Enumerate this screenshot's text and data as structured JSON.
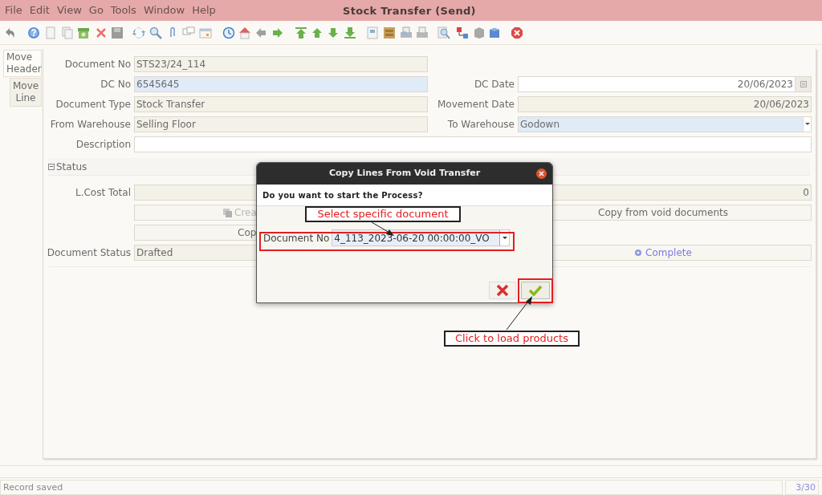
{
  "window": {
    "title": "Stock Transfer (Send)"
  },
  "menu": [
    "File",
    "Edit",
    "View",
    "Go",
    "Tools",
    "Window",
    "Help"
  ],
  "tabs": [
    {
      "label": "Move Header",
      "selected": true
    },
    {
      "label": "Move Line",
      "selected": false
    }
  ],
  "form": {
    "rows": [
      {
        "left": {
          "label": "Document No",
          "value": "STS23/24_114",
          "kind": "readonly"
        }
      },
      {
        "left": {
          "label": "DC No",
          "value": "6545645",
          "kind": "mandatory"
        },
        "right": {
          "label": "DC Date",
          "value": "20/06/2023",
          "kind": "editable",
          "has_calendar": true
        }
      },
      {
        "left": {
          "label": "Document Type",
          "value": "Stock Transfer",
          "kind": "readonly"
        },
        "right": {
          "label": "Movement Date",
          "value": "20/06/2023",
          "kind": "readonly"
        }
      },
      {
        "left": {
          "label": "From Warehouse",
          "value": "Selling Floor",
          "kind": "readonly"
        },
        "right": {
          "label": "To Warehouse",
          "value": "Godown",
          "kind": "mandatory",
          "has_dropdown": true
        }
      },
      {
        "full": {
          "label": "Description",
          "kind": "editable"
        }
      }
    ],
    "section": {
      "title": "Status",
      "expanded": true
    },
    "total": {
      "label": "L.Cost Total",
      "value": "0"
    },
    "buttons_row": [
      {
        "label": "Crea"
      },
      {
        "label": "Copy from void documents"
      }
    ],
    "copy_button": {
      "label": "Cop"
    },
    "status": {
      "label": "Document Status",
      "value": "Drafted",
      "action": "Complete"
    }
  },
  "dialog": {
    "title": "Copy Lines From Void Transfer",
    "question": "Do you want to start the Process?",
    "field_label": "Document No",
    "field_value": "4_113_2023-06-20 00:00:00_VO"
  },
  "callouts": [
    {
      "text": "Select specific document"
    },
    {
      "text": "Click to load products"
    }
  ],
  "status_bar": {
    "message": "Record saved",
    "record": "3/30"
  }
}
